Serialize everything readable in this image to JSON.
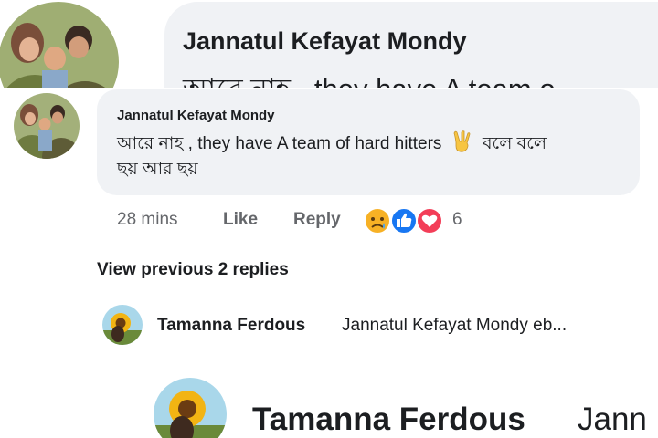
{
  "top_zoom": {
    "author": "Jannatul Kefayat Mondy",
    "partial_text": "আরে নাহ , they have A team o"
  },
  "comment": {
    "author": "Jannatul Kefayat Mondy",
    "text_line1_before_emoji": "আরে নাহ , they have A team of hard hitters",
    "text_line1_after_emoji": "বলে বলে",
    "text_line2": "ছয় আর ছয়",
    "emoji": "victory-hand-icon",
    "time": "28 mins",
    "like_label": "Like",
    "reply_label": "Reply",
    "reaction_icons": [
      "sad-react-icon",
      "like-react-icon",
      "love-react-icon"
    ],
    "reaction_count": "6"
  },
  "view_previous_label": "View previous 2 replies",
  "reply": {
    "author": "Tamanna Ferdous",
    "text": "Jannatul Kefayat Mondy eb..."
  },
  "bottom_zoom": {
    "author": "Tamanna Ferdous",
    "partial_text": "Jann"
  },
  "colors": {
    "bubble": "#f0f2f5",
    "secondary_text": "#65676b",
    "like_blue": "#1877f2",
    "love_red": "#f33e58",
    "sad_yellow": "#f7b125"
  }
}
